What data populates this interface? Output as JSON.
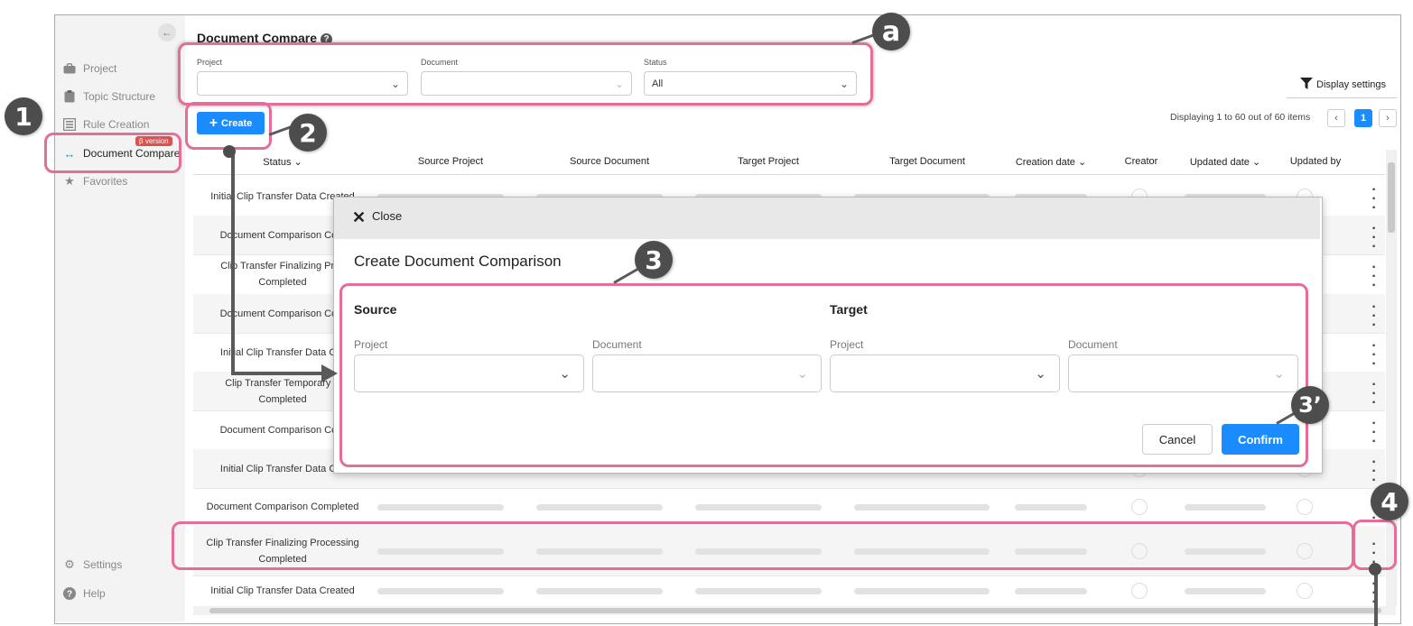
{
  "sidebar": {
    "collapse_icon": "arrow-left-icon",
    "items": [
      {
        "label": "Project",
        "icon": "briefcase-icon"
      },
      {
        "label": "Topic Structure",
        "icon": "clipboard-icon"
      },
      {
        "label": "Rule Creation",
        "icon": "rule-book-icon"
      },
      {
        "label": "Document Compare",
        "icon": "compare-arrows-icon",
        "badge": "β version",
        "active": true
      },
      {
        "label": "Favorites",
        "icon": "star-icon"
      }
    ],
    "bottom": [
      {
        "label": "Settings",
        "icon": "gear-icon"
      },
      {
        "label": "Help",
        "icon": "help-circle-icon"
      }
    ]
  },
  "header": {
    "title": "Document Compare",
    "help": "?"
  },
  "filters": {
    "project": {
      "label": "Project",
      "value": ""
    },
    "document": {
      "label": "Document",
      "value": ""
    },
    "status": {
      "label": "Status",
      "value": "All"
    }
  },
  "toolbar": {
    "create_label": "Create",
    "create_plus": "+",
    "display_settings_label": "Display settings",
    "paging_text": "Displaying 1 to 60 out of 60 items",
    "current_page": "1",
    "prev": "‹",
    "next": "›"
  },
  "table": {
    "columns": [
      "Status",
      "Source Project",
      "Source Document",
      "Target Project",
      "Target Document",
      "Creation date",
      "Creator",
      "Updated date",
      "Updated by"
    ],
    "sort_marker": "⌄",
    "rows": [
      {
        "status": "Initial Clip Transfer Data Created"
      },
      {
        "status": "Document Comparison Com"
      },
      {
        "status": "Clip Transfer Finalizing Proc",
        "status2": "Completed"
      },
      {
        "status": "Document Comparison Com"
      },
      {
        "status": "Initial Clip Transfer Data Cre"
      },
      {
        "status": "Clip Transfer Temporary S",
        "status2": "Completed"
      },
      {
        "status": "Document Comparison Com"
      },
      {
        "status": "Initial Clip Transfer Data Cre"
      },
      {
        "status": "Document Comparison Completed"
      },
      {
        "status": "Clip Transfer Finalizing Processing",
        "status2": "Completed"
      },
      {
        "status": "Initial Clip Transfer Data Created"
      }
    ]
  },
  "modal": {
    "close_label": "Close",
    "title": "Create Document Comparison",
    "source_title": "Source",
    "target_title": "Target",
    "project_label": "Project",
    "document_label": "Document",
    "cancel_label": "Cancel",
    "confirm_label": "Confirm"
  },
  "callouts": {
    "a": "a",
    "one": "1",
    "two": "2",
    "three": "3",
    "three_prime": "3’",
    "four": "4"
  },
  "colors": {
    "accent": "#1a8cff",
    "highlight": "#e46d9a",
    "badge": "#4d4d4d",
    "beta": "#d9534f"
  }
}
